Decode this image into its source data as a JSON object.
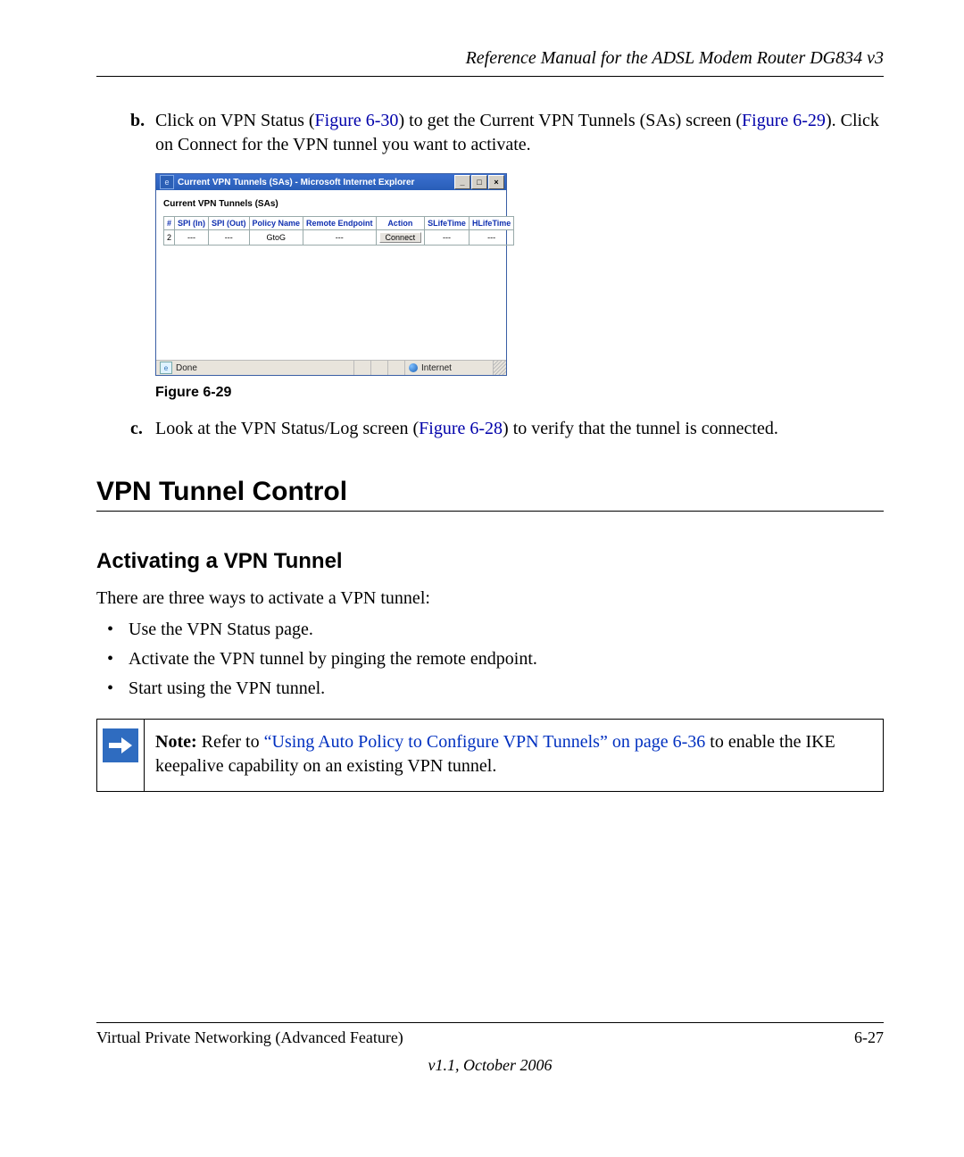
{
  "header": {
    "title": "Reference Manual for the ADSL Modem Router DG834 v3"
  },
  "item_b": {
    "label": "b.",
    "text_before_link1": "Click on VPN Status (",
    "link1": "Figure 6-30",
    "text_mid1": ") to get the Current VPN Tunnels (SAs) screen (",
    "link2": "Figure 6-29",
    "text_after": "). Click on Connect for the VPN tunnel you want to activate."
  },
  "screenshot": {
    "window_title": "Current VPN Tunnels (SAs) - Microsoft Internet Explorer",
    "heading": "Current VPN Tunnels (SAs)",
    "columns": [
      "#",
      "SPI (In)",
      "SPI (Out)",
      "Policy Name",
      "Remote Endpoint",
      "Action",
      "SLifeTime",
      "HLifeTime"
    ],
    "row": {
      "num": "2",
      "spi_in": "---",
      "spi_out": "---",
      "policy": "GtoG",
      "remote": "---",
      "action": "Connect",
      "slife": "---",
      "hlife": "---"
    },
    "status_done": "Done",
    "status_zone": "Internet"
  },
  "figure_caption": "Figure 6-29",
  "item_c": {
    "label": "c.",
    "text_before": "Look at the VPN Status/Log screen (",
    "link": "Figure 6-28",
    "text_after": ") to verify that the tunnel is connected."
  },
  "h1": "VPN Tunnel Control",
  "h2": "Activating a VPN Tunnel",
  "intro": "There are three ways to activate a VPN tunnel:",
  "bullets": [
    "Use the VPN Status page.",
    "Activate the VPN tunnel by pinging the remote endpoint.",
    "Start using the VPN tunnel."
  ],
  "note": {
    "bold": "Note:",
    "before_link": " Refer to ",
    "link": "“Using Auto Policy to Configure VPN Tunnels” on page 6-36",
    "after_link": " to enable the IKE keepalive capability on an existing VPN tunnel."
  },
  "footer": {
    "left": "Virtual Private Networking (Advanced Feature)",
    "right": "6-27",
    "version": "v1.1, October 2006"
  }
}
